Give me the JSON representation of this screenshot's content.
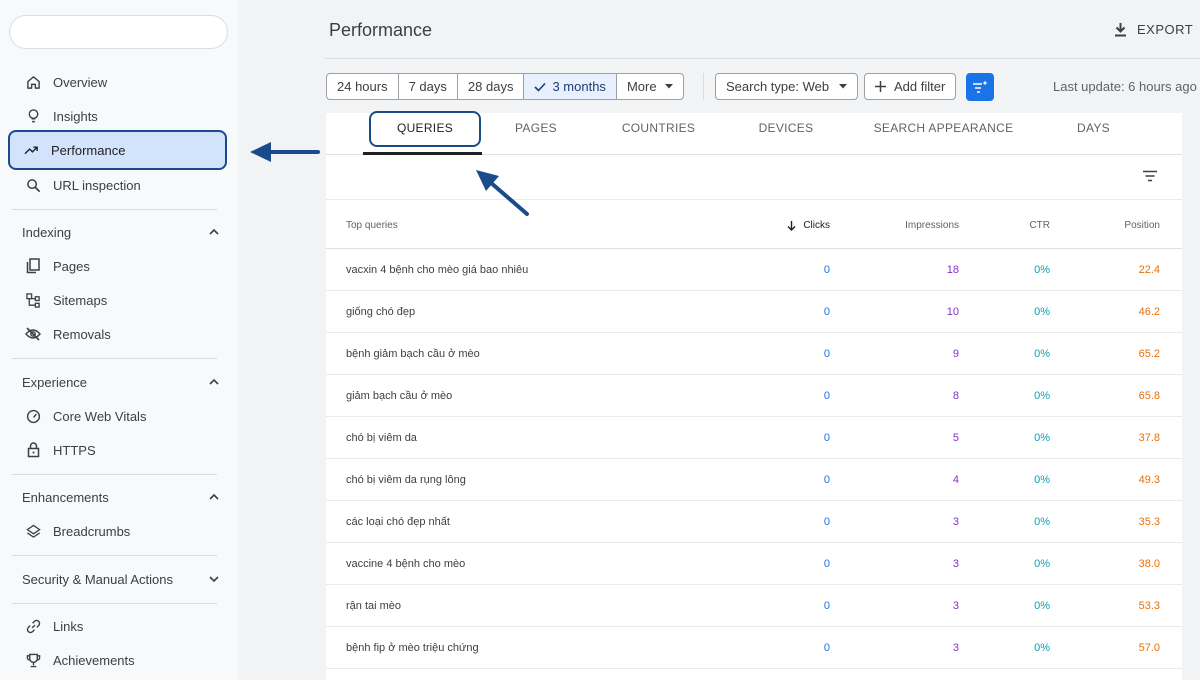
{
  "sidebar": {
    "items": [
      {
        "label": "Overview",
        "icon": "home-icon"
      },
      {
        "label": "Insights",
        "icon": "lightbulb-icon"
      },
      {
        "label": "Performance",
        "icon": "trending-up-icon"
      },
      {
        "label": "URL inspection",
        "icon": "search-icon"
      }
    ],
    "indexing": {
      "title": "Indexing",
      "items": [
        {
          "label": "Pages",
          "icon": "pages-icon"
        },
        {
          "label": "Sitemaps",
          "icon": "sitemap-icon"
        },
        {
          "label": "Removals",
          "icon": "eye-off-icon"
        }
      ]
    },
    "experience": {
      "title": "Experience",
      "items": [
        {
          "label": "Core Web Vitals",
          "icon": "gauge-icon"
        },
        {
          "label": "HTTPS",
          "icon": "lock-icon"
        }
      ]
    },
    "enhancements": {
      "title": "Enhancements",
      "items": [
        {
          "label": "Breadcrumbs",
          "icon": "layers-icon"
        }
      ]
    },
    "security": {
      "title": "Security & Manual Actions"
    },
    "bottom": [
      {
        "label": "Links",
        "icon": "link-icon"
      },
      {
        "label": "Achievements",
        "icon": "trophy-icon"
      }
    ]
  },
  "header": {
    "title": "Performance",
    "export_label": "EXPORT"
  },
  "toolbar": {
    "ranges": [
      "24 hours",
      "7 days",
      "28 days",
      "3 months",
      "More"
    ],
    "selected_range": "3 months",
    "search_type": "Search type: Web",
    "add_filter": "Add filter",
    "last_update": "Last update: 6 hours ago"
  },
  "tabs": [
    "QUERIES",
    "PAGES",
    "COUNTRIES",
    "DEVICES",
    "SEARCH APPEARANCE",
    "DAYS"
  ],
  "active_tab": "QUERIES",
  "table": {
    "headers": {
      "query": "Top queries",
      "clicks": "Clicks",
      "impressions": "Impressions",
      "ctr": "CTR",
      "position": "Position"
    },
    "rows": [
      {
        "query": "vacxin 4 bệnh cho mèo giá bao nhiêu",
        "clicks": "0",
        "impressions": "18",
        "ctr": "0%",
        "position": "22.4"
      },
      {
        "query": "giống chó đẹp",
        "clicks": "0",
        "impressions": "10",
        "ctr": "0%",
        "position": "46.2"
      },
      {
        "query": "bệnh giảm bạch cầu ở mèo",
        "clicks": "0",
        "impressions": "9",
        "ctr": "0%",
        "position": "65.2"
      },
      {
        "query": "giảm bạch cầu ở mèo",
        "clicks": "0",
        "impressions": "8",
        "ctr": "0%",
        "position": "65.8"
      },
      {
        "query": "chó bị viêm da",
        "clicks": "0",
        "impressions": "5",
        "ctr": "0%",
        "position": "37.8"
      },
      {
        "query": "chó bị viêm da rụng lông",
        "clicks": "0",
        "impressions": "4",
        "ctr": "0%",
        "position": "49.3"
      },
      {
        "query": "các loại chó đẹp nhất",
        "clicks": "0",
        "impressions": "3",
        "ctr": "0%",
        "position": "35.3"
      },
      {
        "query": "vaccine 4 bệnh cho mèo",
        "clicks": "0",
        "impressions": "3",
        "ctr": "0%",
        "position": "38.0"
      },
      {
        "query": "rận tai mèo",
        "clicks": "0",
        "impressions": "3",
        "ctr": "0%",
        "position": "53.3"
      },
      {
        "query": "bệnh fip ở mèo triệu chứng",
        "clicks": "0",
        "impressions": "3",
        "ctr": "0%",
        "position": "57.0"
      }
    ]
  },
  "colors": {
    "accent": "#1a73e8",
    "annotation": "#1a4c8b",
    "clicks": "#1a73e8",
    "impressions": "#8430ce",
    "ctr": "#129eaf",
    "position": "#e8710a"
  }
}
